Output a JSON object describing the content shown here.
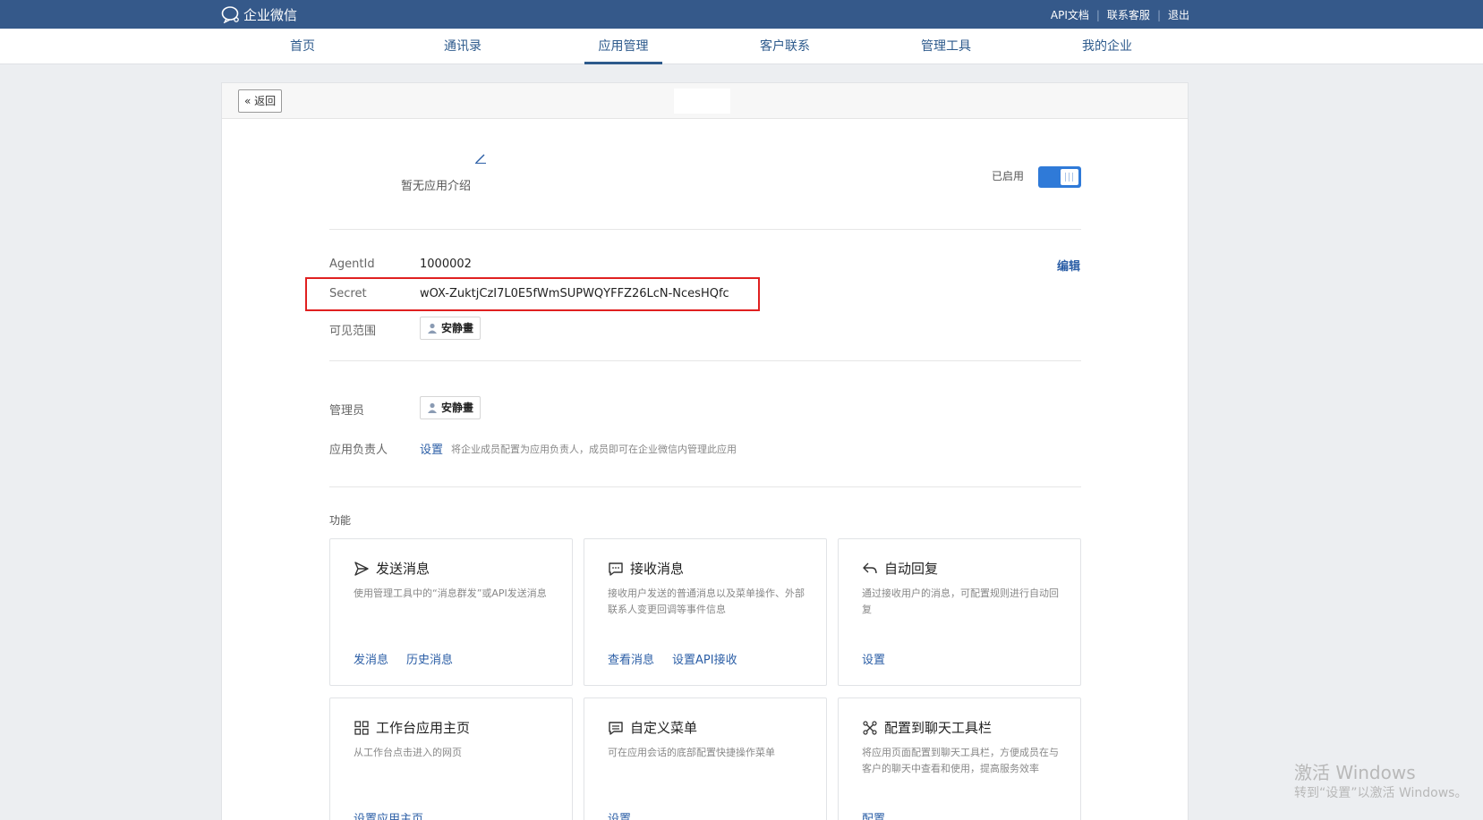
{
  "topbar": {
    "brand": "企业微信",
    "links": [
      "API文档",
      "联系客服",
      "退出"
    ]
  },
  "nav": {
    "items": [
      "首页",
      "通讯录",
      "应用管理",
      "客户联系",
      "管理工具",
      "我的企业"
    ],
    "active": "应用管理"
  },
  "panel": {
    "back_label": "返回",
    "intro": "暂无应用介绍",
    "enabled_label": "已启用",
    "enabled": true,
    "agentid_label": "AgentId",
    "agentid_value": "1000002",
    "edit_label": "编辑",
    "secret_label": "Secret",
    "secret_value": "wOX-ZuktjCzI7L0E5fWmSUPWQYFFZ26LcN-NcesHQfc",
    "visible_label": "可见范围",
    "visible_member": "安静畫",
    "admin_label": "管理员",
    "admin_member": "安静畫",
    "owner_label": "应用负责人",
    "owner_set_label": "设置",
    "owner_hint": "将企业成员配置为应用负责人，成员即可在企业微信内管理此应用",
    "features_title": "功能"
  },
  "cards": [
    {
      "title": "发送消息",
      "icon": "send-icon",
      "desc": "使用管理工具中的“消息群发”或API发送消息",
      "links": [
        "发消息",
        "历史消息"
      ]
    },
    {
      "title": "接收消息",
      "icon": "chat-bubble-icon",
      "desc": "接收用户发送的普通消息以及菜单操作、外部联系人变更回调等事件信息",
      "links": [
        "查看消息",
        "设置API接收"
      ]
    },
    {
      "title": "自动回复",
      "icon": "reply-icon",
      "desc": "通过接收用户的消息，可配置规则进行自动回复",
      "links": [
        "设置"
      ]
    },
    {
      "title": "工作台应用主页",
      "icon": "grid-icon",
      "desc": "从工作台点击进入的网页",
      "links": [
        "设置应用主页"
      ]
    },
    {
      "title": "自定义菜单",
      "icon": "menu-icon",
      "desc": "可在应用会话的底部配置快捷操作菜单",
      "links": [
        "设置"
      ]
    },
    {
      "title": "配置到聊天工具栏",
      "icon": "tools-icon",
      "desc": "将应用页面配置到聊天工具栏，方便成员在与客户的聊天中查看和使用，提高服务效率",
      "links": [
        "配置"
      ]
    }
  ],
  "watermark": {
    "line1": "激活 Windows",
    "line2": "转到“设置”以激活 Windows。"
  },
  "colors": {
    "topbar": "#35598a",
    "accent": "#2b5ea6",
    "toggle": "#2f7ad8",
    "highlight": "#e02020"
  }
}
